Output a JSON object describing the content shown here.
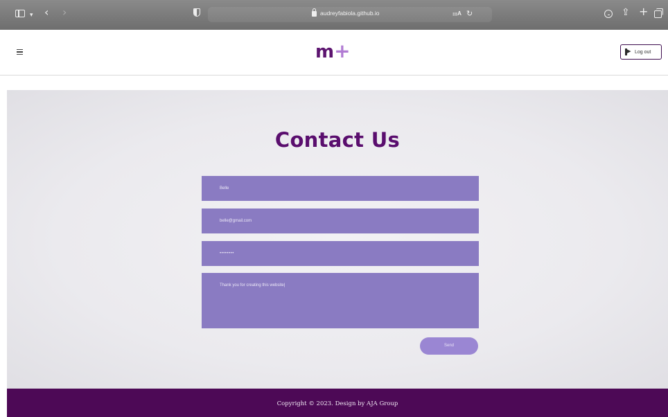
{
  "browser": {
    "url": "audreyfabiola.github.io"
  },
  "header": {
    "logo_main": "m",
    "logo_accent": "+",
    "logout_label": "Log out"
  },
  "main": {
    "title": "Contact Us",
    "form": {
      "name_value": "Belle",
      "email_value": "belle@gmail.com",
      "password_value": "••••••••",
      "message_value": "Thank you for creating this website|",
      "send_label": "Send"
    }
  },
  "footer": {
    "copyright": "Copyright © 2023. Design by AJA Group"
  },
  "colors": {
    "brand_purple": "#5a0e6e",
    "field_purple": "#8a7bc2",
    "footer_bg": "#4d0956"
  }
}
